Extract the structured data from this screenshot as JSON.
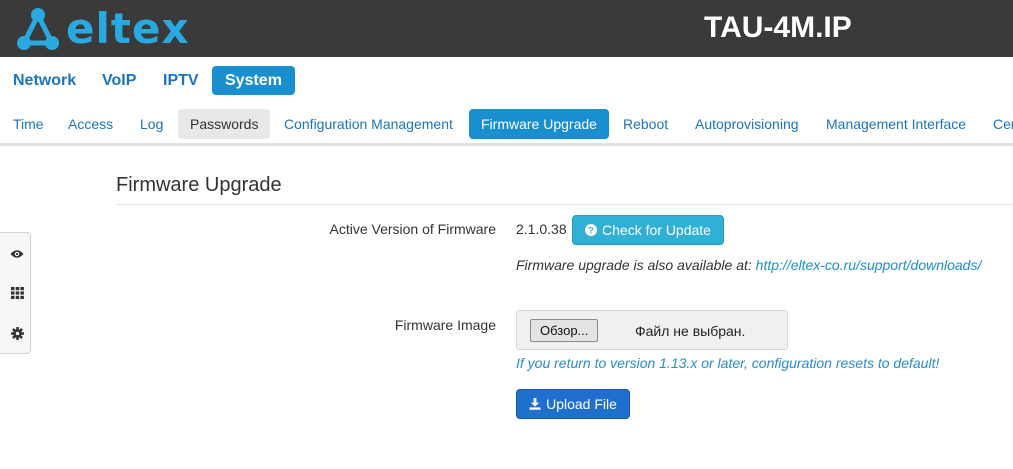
{
  "header": {
    "logo_text": "eltex",
    "logo_icon": "eltex-network-logo-icon",
    "device_name": "TAU-4M.IP"
  },
  "main_nav": {
    "items": [
      {
        "label": "Network"
      },
      {
        "label": "VoIP"
      },
      {
        "label": "IPTV"
      },
      {
        "label": "System",
        "active": true
      }
    ]
  },
  "sub_nav": {
    "items": [
      {
        "label": "Time"
      },
      {
        "label": "Access"
      },
      {
        "label": "Log"
      },
      {
        "label": "Passwords",
        "hover": true
      },
      {
        "label": "Configuration Management"
      },
      {
        "label": "Firmware Upgrade",
        "active": true
      },
      {
        "label": "Reboot"
      },
      {
        "label": "Autoprovisioning"
      },
      {
        "label": "Management Interface"
      },
      {
        "label": "Cer"
      }
    ]
  },
  "side_tools": {
    "icons": [
      "eye-icon",
      "grid-icon",
      "gear-icon"
    ]
  },
  "content": {
    "title": "Firmware Upgrade",
    "active_version_label": "Active Version of Firmware",
    "active_version": "2.1.0.38",
    "check_button": "Check for Update",
    "check_button_icon": "question-circle-icon",
    "hint_prefix": "Firmware upgrade is also available at:",
    "hint_link": "http://eltex-co.ru/support/downloads/",
    "image_label": "Firmware Image",
    "file_button": "Обзор...",
    "file_status": "Файл не выбран.",
    "warning": "If you return to version 1.13.x or later, configuration resets to default!",
    "upload_button": "Upload File",
    "upload_button_icon": "download-icon"
  },
  "colors": {
    "header_bg": "#3a3a3a",
    "brand": "#29a9e0",
    "nav_link": "#1a75bb",
    "active_bg": "#1a8fcf",
    "info_button": "#31b0d5",
    "primary_button": "#1f6fcf"
  }
}
